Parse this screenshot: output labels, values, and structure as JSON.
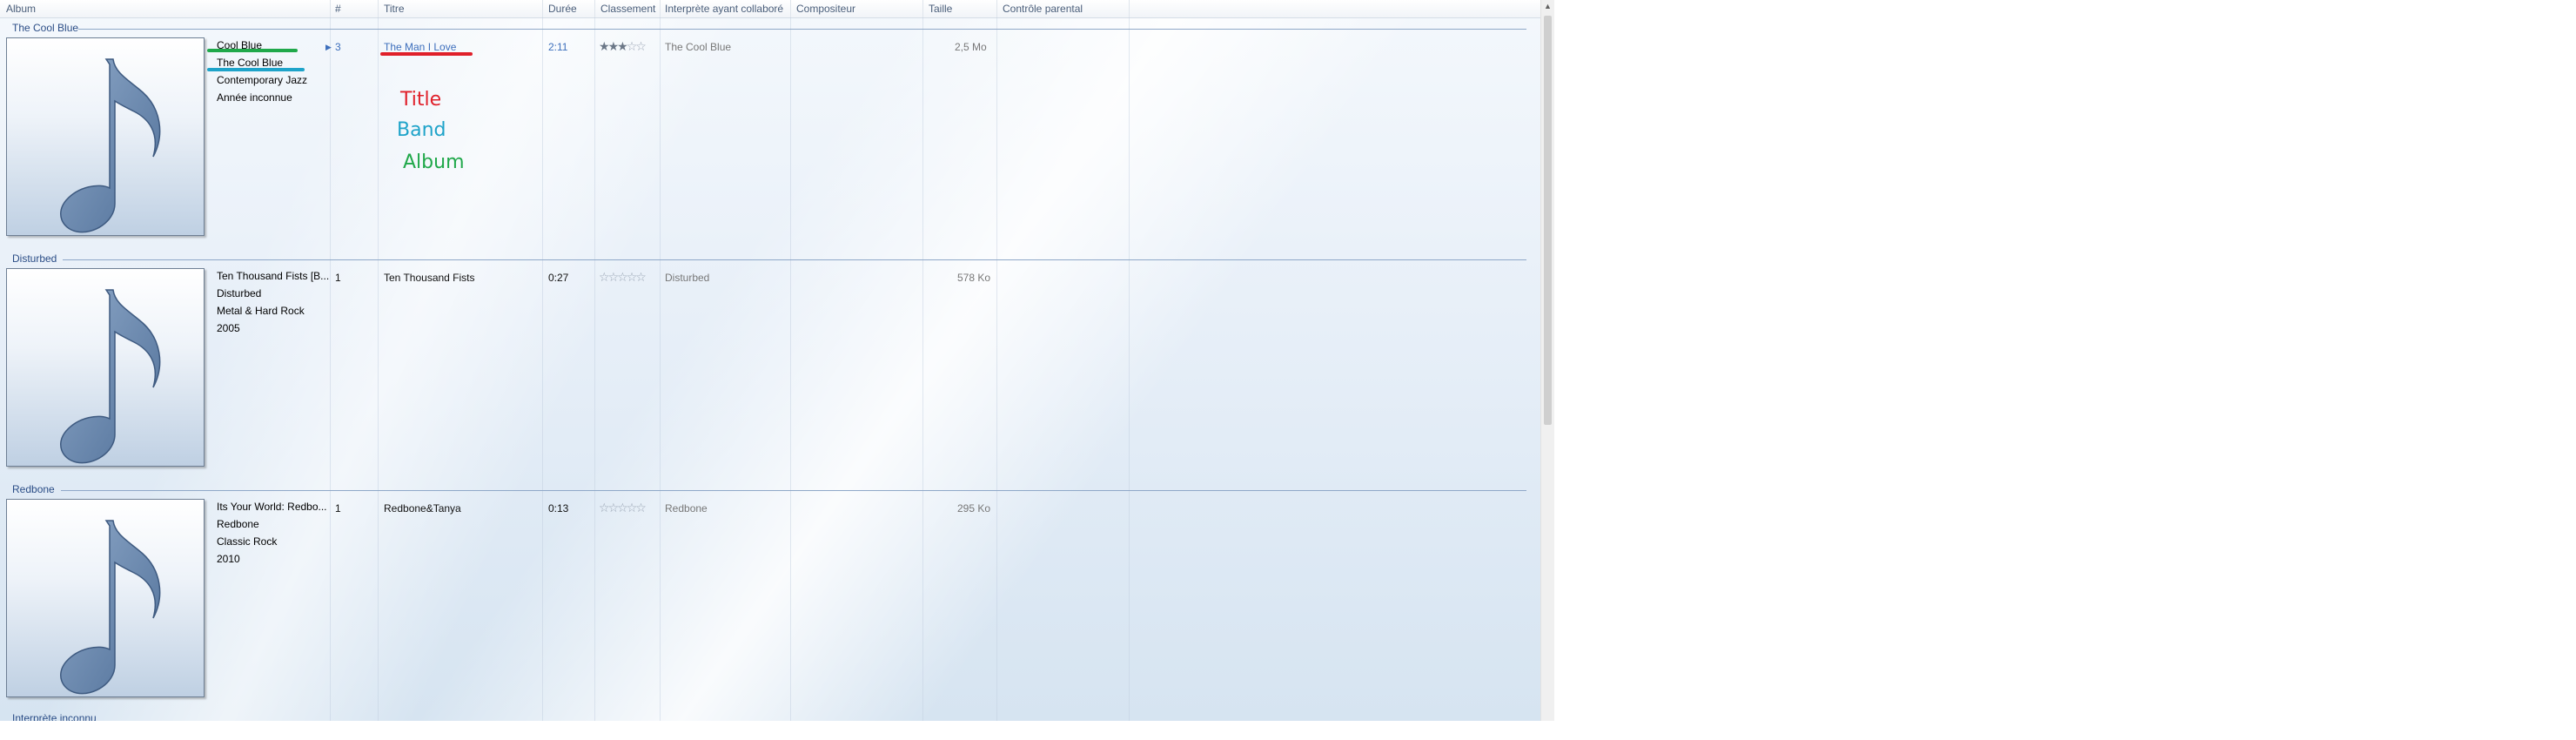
{
  "columns": [
    {
      "id": "album",
      "label": "Album"
    },
    {
      "id": "track_no",
      "label": "#"
    },
    {
      "id": "title",
      "label": "Titre"
    },
    {
      "id": "duration",
      "label": "Durée"
    },
    {
      "id": "rating",
      "label": "Classement"
    },
    {
      "id": "contributing_artist",
      "label": "Interprète ayant collaboré"
    },
    {
      "id": "composer",
      "label": "Compositeur"
    },
    {
      "id": "size",
      "label": "Taille"
    },
    {
      "id": "parental",
      "label": "Contrôle parental"
    }
  ],
  "groups": [
    {
      "name": "The Cool Blue",
      "album": "Cool Blue",
      "artist": "The Cool Blue",
      "genre": "Contemporary Jazz",
      "year": "Année inconnue",
      "track_no": "3",
      "title": "The Man I Love",
      "duration": "2:11",
      "rating": 3,
      "contributing_artist": "The Cool Blue",
      "size": "2,5 Mo",
      "selected": true
    },
    {
      "name": "Disturbed",
      "album": "Ten Thousand Fists [B...",
      "artist": "Disturbed",
      "genre": "Metal & Hard Rock",
      "year": "2005",
      "track_no": "1",
      "title": "Ten Thousand Fists",
      "duration": "0:27",
      "rating": 0,
      "contributing_artist": "Disturbed",
      "size": "578 Ko",
      "selected": false
    },
    {
      "name": "Redbone",
      "album": "Its Your World: Redbo...",
      "artist": "Redbone",
      "genre": "Classic Rock",
      "year": "2010",
      "track_no": "1",
      "title": "Redbone&Tanya",
      "duration": "0:13",
      "rating": 0,
      "contributing_artist": "Redbone",
      "size": "295 Ko",
      "selected": false
    }
  ],
  "next_group_partial": "Interprète inconnu",
  "annotations": [
    {
      "text": "Title",
      "color": "#e0202a"
    },
    {
      "text": "Band",
      "color": "#1ea3c9"
    },
    {
      "text": "Album",
      "color": "#20a84a"
    }
  ],
  "colors": {
    "underline_title": "#e0202a",
    "underline_band": "#1ea3c9",
    "underline_album": "#20a84a",
    "selected_text": "#3d6fbc",
    "group_header": "#2b4d86"
  },
  "icons": {
    "album_art": "music-note-icon",
    "scroll_up": "arrow-up-icon",
    "star": "star-icon"
  }
}
